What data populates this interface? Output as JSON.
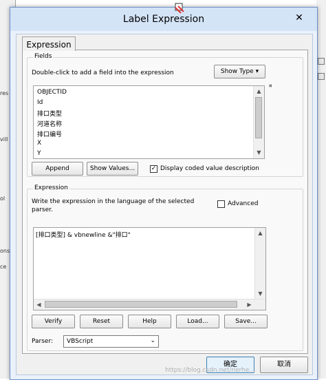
{
  "background_app": {
    "left_fragments": [
      "res",
      "vill",
      "ol",
      "ons",
      "ce"
    ]
  },
  "window": {
    "title": "Label Expression",
    "close_glyph": "✕"
  },
  "tabs": [
    {
      "label": "Expression"
    }
  ],
  "fields_group": {
    "label": "Fields",
    "hint": "Double-click to add a field into the expression",
    "show_type_label": "Show Type",
    "fields": [
      "OBJECTID",
      "Id",
      "排口类型",
      "河道名称",
      "排口编号",
      "X",
      "Y"
    ],
    "append_label": "Append",
    "show_values_label": "Show Values...",
    "display_coded_checked": true,
    "display_coded_label": "Display coded value description"
  },
  "expression_group": {
    "label": "Expression",
    "instruction": "Write the expression in the language of the selected parser.",
    "advanced_checked": false,
    "advanced_label": "Advanced",
    "expression_text": "[排口类型] & vbnewline &\"排口\"",
    "verify_label": "Verify",
    "reset_label": "Reset",
    "help_label": "Help",
    "load_label": "Load...",
    "save_label": "Save..."
  },
  "parser": {
    "label": "Parser:",
    "selected": "VBScript"
  },
  "footer": {
    "ok_label": "确定",
    "cancel_label": "取消",
    "watermark": "https://blog.csdn.net/nerhe..."
  },
  "colors": {
    "titlebar": "#d4e4f7",
    "window_border": "#6a8fc9",
    "ok_border": "#3c7fb1",
    "ok_fill": "#e5f1fb"
  }
}
